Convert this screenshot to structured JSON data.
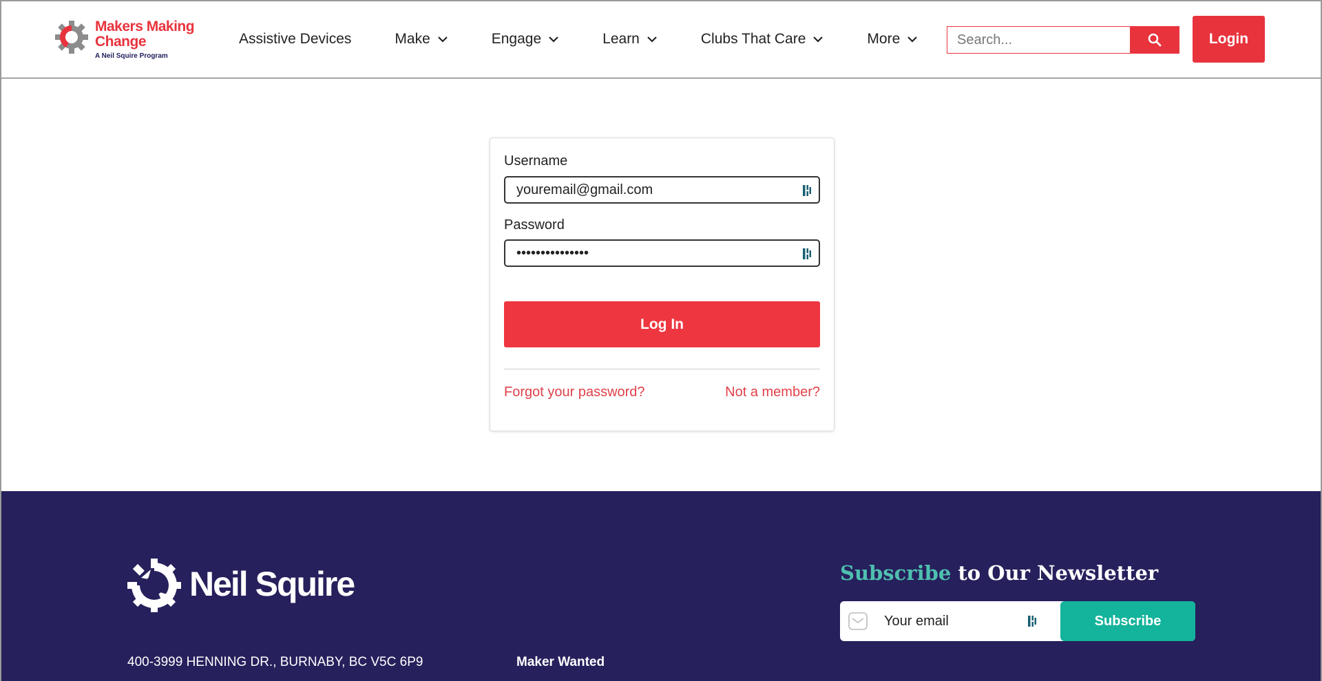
{
  "brand": {
    "title": "Makers Making Change",
    "subtitle": "A Neil Squire Program",
    "accent_color": "#e8333d",
    "navy_color": "#26205c",
    "teal_color": "#14b39b"
  },
  "nav": {
    "items": [
      {
        "label": "Assistive Devices",
        "has_dropdown": false
      },
      {
        "label": "Make",
        "has_dropdown": true
      },
      {
        "label": "Engage",
        "has_dropdown": true
      },
      {
        "label": "Learn",
        "has_dropdown": true
      },
      {
        "label": "Clubs That Care",
        "has_dropdown": true
      },
      {
        "label": "More",
        "has_dropdown": true
      }
    ],
    "search_placeholder": "Search...",
    "search_icon": "search-icon",
    "login_label": "Login"
  },
  "login_form": {
    "username_label": "Username",
    "username_value": "youremail@gmail.com",
    "password_label": "Password",
    "password_value": "•••••••••••••••",
    "submit_label": "Log In",
    "forgot_link": "Forgot your password?",
    "register_link": "Not a member?"
  },
  "footer": {
    "org_name": "Neil Squire",
    "address": "400-3999 HENNING DR., BURNABY, BC V5C 6P9",
    "column_heading": "Maker Wanted",
    "newsletter_title_accent": "Subscribe",
    "newsletter_title_rest": " to Our Newsletter",
    "email_placeholder": "Your email",
    "subscribe_label": "Subscribe"
  }
}
